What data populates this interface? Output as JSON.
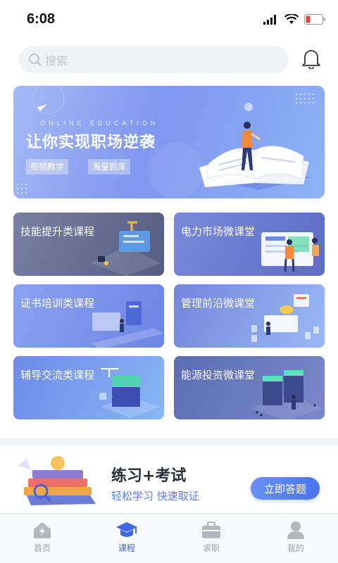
{
  "status": {
    "time": "6:08"
  },
  "search": {
    "placeholder": "搜索"
  },
  "banner": {
    "subtitle": "ONLINE EDUCATION",
    "title": "让你实现职场逆袭",
    "tags": [
      "视频教学",
      "海量题库"
    ]
  },
  "cards": [
    {
      "label": "技能提升类课程"
    },
    {
      "label": "电力市场微课堂"
    },
    {
      "label": "证书培训类课程"
    },
    {
      "label": "管理前沿微课堂"
    },
    {
      "label": "辅导交流类课程"
    },
    {
      "label": "能源投资微课堂"
    }
  ],
  "promo": {
    "title": "练习+考试",
    "subtitle": "轻松学习  快速取证",
    "button": "立即答题"
  },
  "tabs": [
    {
      "label": "首页",
      "icon": "home-icon"
    },
    {
      "label": "课程",
      "icon": "graduation-cap-icon"
    },
    {
      "label": "求职",
      "icon": "briefcase-icon"
    },
    {
      "label": "我的",
      "icon": "person-icon"
    }
  ],
  "colors": {
    "accent": "#3f6ae6",
    "banner": "#7f97f0"
  }
}
